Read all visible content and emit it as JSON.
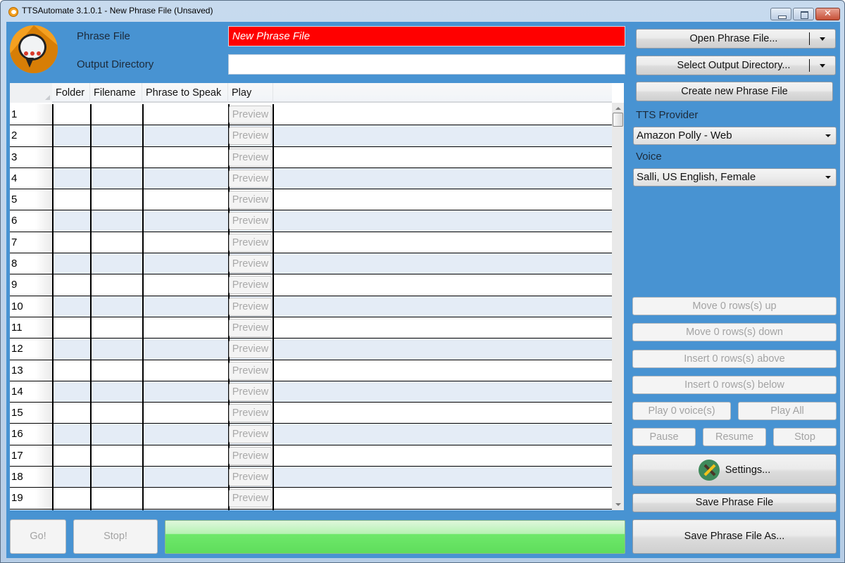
{
  "window": {
    "title": "TTSAutomate 3.1.0.1 - New Phrase File (Unsaved)",
    "controls": {
      "minimize": "minimize",
      "maximize": "maximize",
      "close": "✕"
    }
  },
  "header": {
    "phrase_file_label": "Phrase File",
    "phrase_file_value": "New Phrase File",
    "output_directory_label": "Output Directory",
    "output_directory_value": ""
  },
  "grid": {
    "columns": [
      "Folder",
      "Filename",
      "Phrase to Speak",
      "Play"
    ],
    "preview_label": "Preview",
    "rows": [
      {
        "num": "1",
        "folder": "",
        "filename": "",
        "phrase": ""
      },
      {
        "num": "2",
        "folder": "",
        "filename": "",
        "phrase": ""
      },
      {
        "num": "3",
        "folder": "",
        "filename": "",
        "phrase": ""
      },
      {
        "num": "4",
        "folder": "",
        "filename": "",
        "phrase": ""
      },
      {
        "num": "5",
        "folder": "",
        "filename": "",
        "phrase": ""
      },
      {
        "num": "6",
        "folder": "",
        "filename": "",
        "phrase": ""
      },
      {
        "num": "7",
        "folder": "",
        "filename": "",
        "phrase": ""
      },
      {
        "num": "8",
        "folder": "",
        "filename": "",
        "phrase": ""
      },
      {
        "num": "9",
        "folder": "",
        "filename": "",
        "phrase": ""
      },
      {
        "num": "10",
        "folder": "",
        "filename": "",
        "phrase": ""
      },
      {
        "num": "11",
        "folder": "",
        "filename": "",
        "phrase": ""
      },
      {
        "num": "12",
        "folder": "",
        "filename": "",
        "phrase": ""
      },
      {
        "num": "13",
        "folder": "",
        "filename": "",
        "phrase": ""
      },
      {
        "num": "14",
        "folder": "",
        "filename": "",
        "phrase": ""
      },
      {
        "num": "15",
        "folder": "",
        "filename": "",
        "phrase": ""
      },
      {
        "num": "16",
        "folder": "",
        "filename": "",
        "phrase": ""
      },
      {
        "num": "17",
        "folder": "",
        "filename": "",
        "phrase": ""
      },
      {
        "num": "18",
        "folder": "",
        "filename": "",
        "phrase": ""
      },
      {
        "num": "19",
        "folder": "",
        "filename": "",
        "phrase": ""
      },
      {
        "num": "",
        "folder": "",
        "filename": "",
        "phrase": ""
      }
    ]
  },
  "sidebar": {
    "open_phrase_file": "Open Phrase File...",
    "select_output_directory": "Select Output Directory...",
    "create_new_phrase_file": "Create new Phrase File",
    "tts_provider_label": "TTS Provider",
    "tts_provider_value": "Amazon Polly - Web",
    "voice_label": "Voice",
    "voice_value": "Salli, US English, Female",
    "move_up": "Move 0 rows(s) up",
    "move_down": "Move 0 rows(s) down",
    "insert_above": "Insert 0 rows(s) above",
    "insert_below": "Insert 0 rows(s) below",
    "play_voices": "Play 0 voice(s)",
    "play_all": "Play All",
    "pause": "Pause",
    "resume": "Resume",
    "stop": "Stop",
    "settings": "Settings...",
    "save_phrase_file": "Save Phrase File",
    "save_phrase_file_as": "Save Phrase File As..."
  },
  "footer": {
    "go": "Go!",
    "stop": "Stop!",
    "progress_fraction": 1.0,
    "progress_color": "#5fdd5c"
  },
  "colors": {
    "client_background": "#4893d2",
    "phrase_file_field": "#ff0000",
    "alt_row": "#e4ecf6"
  }
}
